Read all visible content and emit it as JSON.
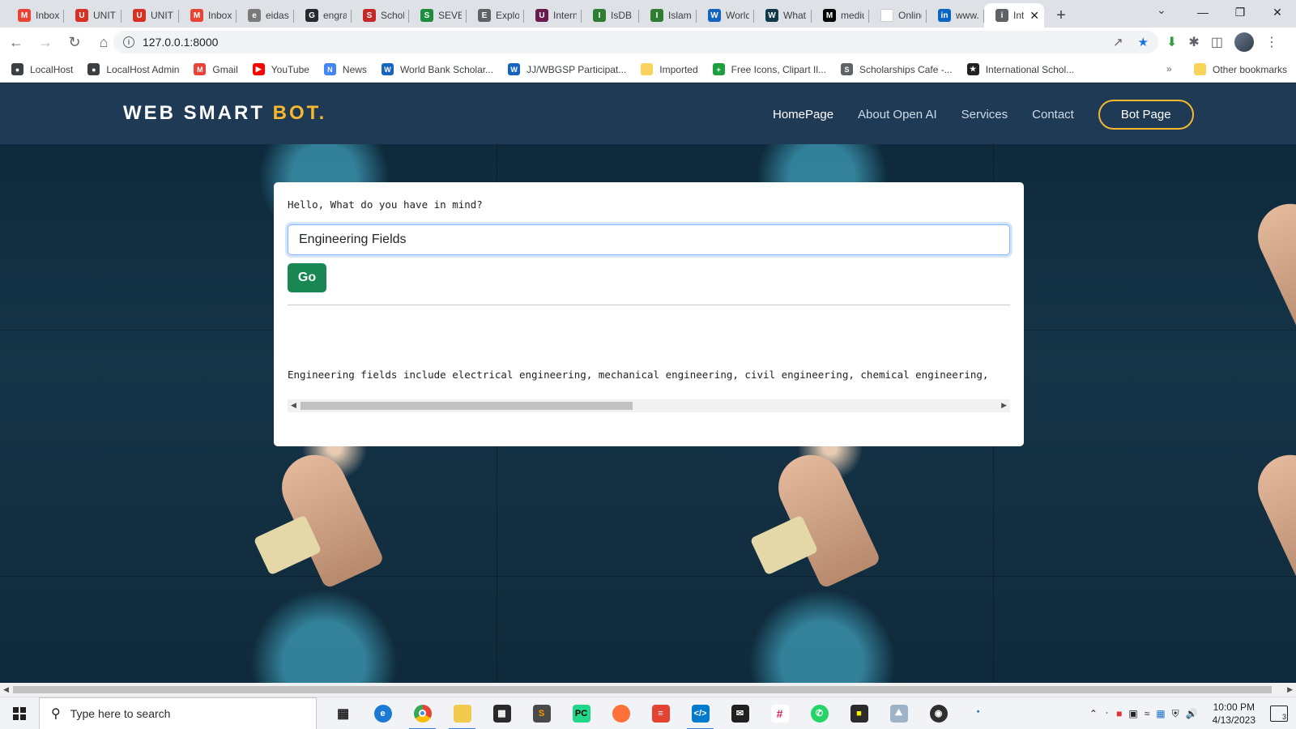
{
  "browser": {
    "tabs": [
      {
        "label": "Inbox",
        "color": "#ea4335",
        "glyph": "M"
      },
      {
        "label": "UNITE",
        "color": "#d93025",
        "glyph": "U"
      },
      {
        "label": "UNITE",
        "color": "#d93025",
        "glyph": "U"
      },
      {
        "label": "Inbox",
        "color": "#ea4335",
        "glyph": "M"
      },
      {
        "label": "eidas.r",
        "color": "#7a7a7a",
        "glyph": "e"
      },
      {
        "label": "engray",
        "color": "#24292f",
        "glyph": "G"
      },
      {
        "label": "Schola",
        "color": "#c62828",
        "glyph": "S"
      },
      {
        "label": "SEVE (",
        "color": "#1e8e3e",
        "glyph": "S"
      },
      {
        "label": "Explor",
        "color": "#5f6368",
        "glyph": "E"
      },
      {
        "label": "Intern",
        "color": "#6a1b4d",
        "glyph": "U"
      },
      {
        "label": "IsDB S",
        "color": "#2e7d32",
        "glyph": "I"
      },
      {
        "label": "Islami",
        "color": "#2e7d32",
        "glyph": "I"
      },
      {
        "label": "World",
        "color": "#1565c0",
        "glyph": "W"
      },
      {
        "label": "What",
        "color": "#0f3a4a",
        "glyph": "W"
      },
      {
        "label": "mediu",
        "color": "#000000",
        "glyph": "M"
      },
      {
        "label": "Online",
        "color": "#ffffff",
        "glyph": ""
      },
      {
        "label": "www.l",
        "color": "#0a66c2",
        "glyph": "in"
      },
      {
        "label": "Int",
        "color": "#5f6368",
        "glyph": "i"
      }
    ],
    "new_tab_label": "+",
    "url": "127.0.0.1:8000",
    "bookmarks": [
      {
        "label": "LocalHost",
        "color": "#3c4043",
        "glyph": "●"
      },
      {
        "label": "LocalHost Admin",
        "color": "#3c4043",
        "glyph": "●"
      },
      {
        "label": "Gmail",
        "color": "#ea4335",
        "glyph": "M"
      },
      {
        "label": "YouTube",
        "color": "#ff0000",
        "glyph": "▶"
      },
      {
        "label": "News",
        "color": "#4285f4",
        "glyph": "N"
      },
      {
        "label": "World Bank Scholar...",
        "color": "#1565c0",
        "glyph": "W"
      },
      {
        "label": "JJ/WBGSP Participat...",
        "color": "#1565c0",
        "glyph": "W"
      },
      {
        "label": "Imported",
        "color": "#f9d45c",
        "glyph": ""
      },
      {
        "label": "Free Icons, Clipart Il...",
        "color": "#1e9e3e",
        "glyph": "+"
      },
      {
        "label": "Scholarships Cafe -...",
        "color": "#5f6368",
        "glyph": "S"
      },
      {
        "label": "International Schol...",
        "color": "#202124",
        "glyph": "★"
      }
    ],
    "bookmarks_more": "»",
    "other_bookmarks": "Other bookmarks"
  },
  "site": {
    "logo_main": "WEB SMART ",
    "logo_accent": "BOT.",
    "nav": {
      "home": "HomePage",
      "about": "About Open AI",
      "services": "Services",
      "contact": "Contact",
      "bot": "Bot Page"
    },
    "accent_color": "#f5b82e",
    "header_color": "#1e3a55"
  },
  "chat": {
    "prompt": "Hello, What do you have in mind?",
    "input_value": "Engineering Fields",
    "go_label": "Go",
    "response": "Engineering fields include electrical engineering, mechanical engineering, civil engineering, chemical engineering,"
  },
  "taskbar": {
    "search_placeholder": "Type here to search",
    "time": "10:00 PM",
    "date": "4/13/2023",
    "notification_count": "3"
  }
}
